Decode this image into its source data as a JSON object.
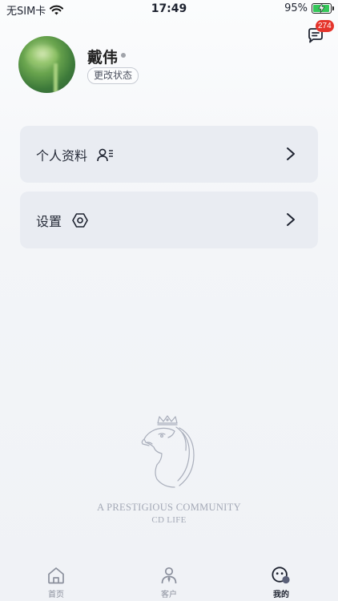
{
  "status_bar": {
    "carrier": "无SIM卡",
    "time": "17:49",
    "battery": "95%",
    "battery_level": 0.95
  },
  "header": {
    "chat_badge": "274",
    "user_name": "戴伟",
    "status_button": "更改状态"
  },
  "menu": [
    {
      "label": "个人资料",
      "icon": "profile-list-icon"
    },
    {
      "label": "设置",
      "icon": "hexagon-settings-icon"
    }
  ],
  "brand": {
    "line1": "A PRESTIGIOUS COMMUNITY",
    "line2": "CD LIFE"
  },
  "tabs": [
    {
      "label": "首页",
      "icon": "home-icon",
      "active": false
    },
    {
      "label": "客户",
      "icon": "customer-icon",
      "active": false
    },
    {
      "label": "我的",
      "icon": "smiley-me-icon",
      "active": true
    }
  ],
  "colors": {
    "badge": "#e5342b",
    "card_bg": "#e9ecf2",
    "battery_green": "#34c759"
  }
}
